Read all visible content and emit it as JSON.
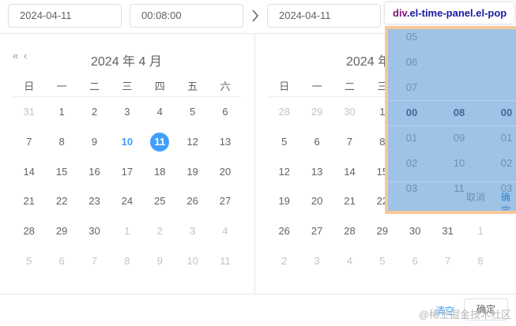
{
  "start_input": {
    "date": "2024-04-11",
    "time": "00:08:00"
  },
  "end_input": {
    "date": "2024-04-11"
  },
  "left": {
    "nav_prev_year": "«",
    "nav_prev_month": "‹",
    "title": "2024 年 4 月",
    "weekdays": [
      "日",
      "一",
      "二",
      "三",
      "四",
      "五",
      "六"
    ],
    "rows": [
      [
        "31",
        "1",
        "2",
        "3",
        "4",
        "5",
        "6"
      ],
      [
        "7",
        "8",
        "9",
        "10",
        "11",
        "12",
        "13"
      ],
      [
        "14",
        "15",
        "16",
        "17",
        "18",
        "19",
        "20"
      ],
      [
        "21",
        "22",
        "23",
        "24",
        "25",
        "26",
        "27"
      ],
      [
        "28",
        "29",
        "30",
        "1",
        "2",
        "3",
        "4"
      ],
      [
        "5",
        "6",
        "7",
        "8",
        "9",
        "10",
        "11"
      ]
    ]
  },
  "right": {
    "title": "2024 年",
    "weekdays": [
      "日",
      "一",
      "二",
      "三"
    ],
    "rows": [
      [
        "28",
        "29",
        "30",
        "1"
      ],
      [
        "5",
        "6",
        "7",
        "8"
      ],
      [
        "12",
        "13",
        "14",
        "15"
      ],
      [
        "19",
        "20",
        "21",
        "22"
      ],
      [
        "26",
        "27",
        "28",
        "29",
        "30",
        "31",
        "1"
      ],
      [
        "2",
        "3",
        "4",
        "5",
        "6",
        "7",
        "8"
      ]
    ]
  },
  "time_panel": {
    "hours": [
      "05",
      "06",
      "07",
      "00",
      "01",
      "02",
      "03"
    ],
    "minutes": [
      "",
      "",
      "",
      "08",
      "09",
      "10",
      "11"
    ],
    "seconds": [
      "",
      "",
      "",
      "00",
      "01",
      "02",
      "03"
    ],
    "cancel": "取消",
    "ok": "确定"
  },
  "tooltip": {
    "tag": "div",
    "classes": ".el-time-panel.el-pop"
  },
  "footer": {
    "clear": "清空",
    "ok": "确定"
  },
  "watermark": "@稀土掘金技术社区",
  "colors": {
    "accent": "#409eff",
    "border": "#dcdfe6",
    "overlay": "#9fc3e6",
    "overlay_border": "#f7c89b"
  }
}
